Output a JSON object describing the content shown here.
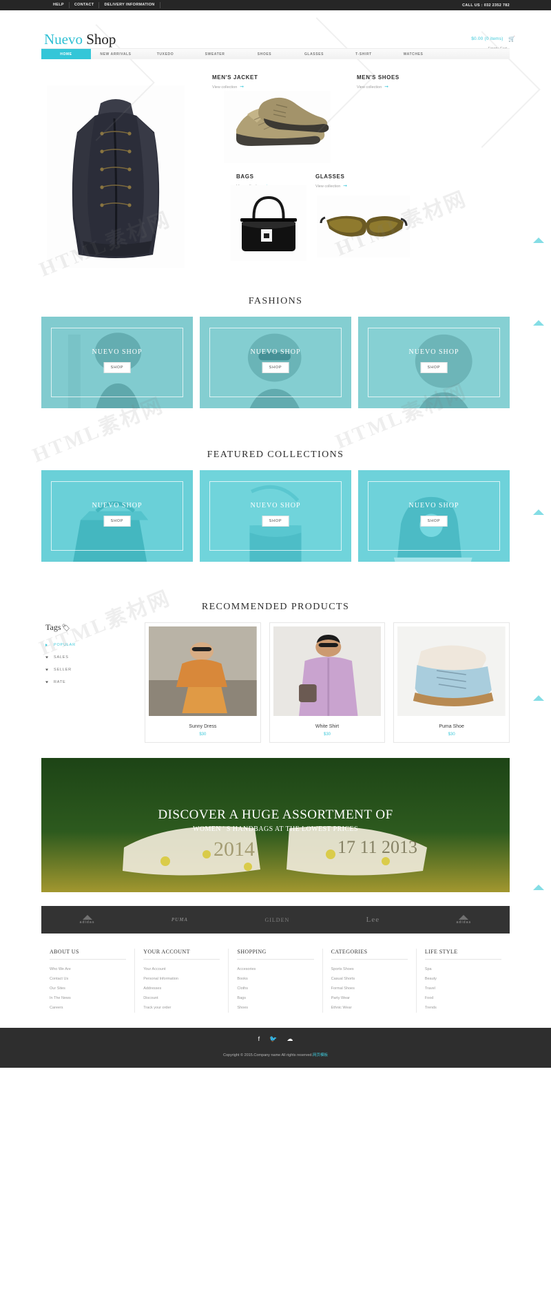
{
  "topbar": {
    "links": [
      "HELP",
      "CONTACT",
      "DELIVERY INFORMATION"
    ],
    "phone": "CALL US : 032 2352 782"
  },
  "header": {
    "logo_first": "Nuevo",
    "logo_second": "Shop",
    "cart_price": "$0.00 (0 items)",
    "cart_status": "Empty Cart",
    "cart_icon": "cart-icon"
  },
  "nav": {
    "items": [
      {
        "label": "HOME",
        "active": true
      },
      {
        "label": "NEW ARRIVALS",
        "active": false
      },
      {
        "label": "TUXEDO",
        "active": false
      },
      {
        "label": "SWEATER",
        "active": false
      },
      {
        "label": "SHOES",
        "active": false
      },
      {
        "label": "GLASSES",
        "active": false
      },
      {
        "label": "T-SHIRT",
        "active": false
      },
      {
        "label": "WATCHES",
        "active": false
      }
    ]
  },
  "hero": {
    "view_collection": "View collection",
    "categories": [
      {
        "title": "MEN'S JACKET",
        "link": "View collection"
      },
      {
        "title": "MEN'S SHOES",
        "link": "View collection"
      },
      {
        "title": "BAGS",
        "link": "View collection"
      },
      {
        "title": "GLASSES",
        "link": "View collection"
      }
    ]
  },
  "sections": {
    "fashions_title": "FASHIONS",
    "featured_title": "FEATURED COLLECTIONS",
    "recommended_title": "RECOMMENDED PRODUCTS"
  },
  "fashions": [
    {
      "title": "NUEVO SHOP",
      "button": "SHOP"
    },
    {
      "title": "NUEVO SHOP",
      "button": "SHOP"
    },
    {
      "title": "NUEVO SHOP",
      "button": "SHOP"
    }
  ],
  "featured": [
    {
      "title": "NUEVO SHOP",
      "button": "SHOP"
    },
    {
      "title": "NUEVO SHOP",
      "button": "SHOP"
    },
    {
      "title": "NUEVO SHOP",
      "button": "SHOP"
    }
  ],
  "tags": {
    "heading": "Tags",
    "icon": "tag-icon",
    "items": [
      {
        "label": "POPULAR",
        "active": true
      },
      {
        "label": "SALES",
        "active": false
      },
      {
        "label": "SELLER",
        "active": false
      },
      {
        "label": "RATE",
        "active": false
      }
    ]
  },
  "products": [
    {
      "name": "Sunny Dress",
      "price": "$30"
    },
    {
      "name": "White Shirt",
      "price": "$30"
    },
    {
      "name": "Puma Shoe",
      "price": "$30"
    }
  ],
  "banner": {
    "line1": "DISCOVER A HUGE ASSORTMENT OF",
    "line2": "WOMEN ' S HANDBAGS AT THE LOWEST PRICES"
  },
  "brands": [
    {
      "name": "adidas",
      "type": "adidas"
    },
    {
      "name": "PUMA",
      "type": "puma"
    },
    {
      "name": "GILDEN",
      "type": "gilden"
    },
    {
      "name": "Lee",
      "type": "lee"
    },
    {
      "name": "adidas",
      "type": "adidas"
    }
  ],
  "footer_columns": [
    {
      "heading": "ABOUT US",
      "links": [
        "Who We Are",
        "Contact Us",
        "Our Sites",
        "In The News",
        "Careers"
      ]
    },
    {
      "heading": "YOUR ACCOUNT",
      "links": [
        "Your Account",
        "Personal Information",
        "Addresses",
        "Discount",
        "Track your order"
      ]
    },
    {
      "heading": "SHOPPING",
      "links": [
        "Accesories",
        "Books",
        "Cloths",
        "Bags",
        "Shoes"
      ]
    },
    {
      "heading": "CATEGORIES",
      "links": [
        "Sports Shoes",
        "Casual Shorts",
        "Formal Shoes",
        "Party Wear",
        "Ethnic Wear"
      ]
    },
    {
      "heading": "LIFE STYLE",
      "links": [
        "Spa",
        "Beauty",
        "Travel",
        "Food",
        "Trends"
      ]
    }
  ],
  "bottom": {
    "social": [
      "facebook-icon",
      "twitter-icon",
      "rss-icon"
    ],
    "copyright_pre": "Copyright © 2015.Company name All rights reserved.",
    "copyright_link": "网页模板"
  },
  "colors": {
    "accent": "#3ec9da",
    "tile": "#6fd4dd",
    "dark": "#2e2e2e",
    "topbar": "#262626"
  }
}
